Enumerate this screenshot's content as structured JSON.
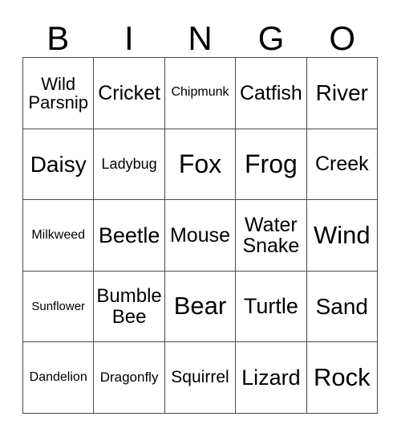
{
  "card": {
    "header": {
      "letters": [
        "B",
        "I",
        "N",
        "G",
        "O"
      ]
    },
    "colors": {
      "background": "#ffffff",
      "border": "#4a4a4a",
      "text": "#000000"
    },
    "grid": {
      "columns": 5,
      "rows": 5,
      "cells": [
        {
          "text": "Wild\nParsnip",
          "size": "fs-22"
        },
        {
          "text": "Cricket",
          "size": "fs-25"
        },
        {
          "text": "Chipmunk",
          "size": "fs-16"
        },
        {
          "text": "Catfish",
          "size": "fs-25"
        },
        {
          "text": "River",
          "size": "fs-28"
        },
        {
          "text": "Daisy",
          "size": "fs-28"
        },
        {
          "text": "Ladybug",
          "size": "fs-18"
        },
        {
          "text": "Fox",
          "size": "fs-32"
        },
        {
          "text": "Frog",
          "size": "fs-32"
        },
        {
          "text": "Creek",
          "size": "fs-25"
        },
        {
          "text": "Milkweed",
          "size": "fs-16"
        },
        {
          "text": "Beetle",
          "size": "fs-27"
        },
        {
          "text": "Mouse",
          "size": "fs-25"
        },
        {
          "text": "Water\nSnake",
          "size": "fs-25"
        },
        {
          "text": "Wind",
          "size": "fs-31"
        },
        {
          "text": "Sunflower",
          "size": "fs-15"
        },
        {
          "text": "Bumble\nBee",
          "size": "fs-24"
        },
        {
          "text": "Bear",
          "size": "fs-31"
        },
        {
          "text": "Turtle",
          "size": "fs-27"
        },
        {
          "text": "Sand",
          "size": "fs-28"
        },
        {
          "text": "Dandelion",
          "size": "fs-16"
        },
        {
          "text": "Dragonfly",
          "size": "fs-17"
        },
        {
          "text": "Squirrel",
          "size": "fs-21"
        },
        {
          "text": "Lizard",
          "size": "fs-27"
        },
        {
          "text": "Rock",
          "size": "fs-31"
        }
      ]
    }
  }
}
